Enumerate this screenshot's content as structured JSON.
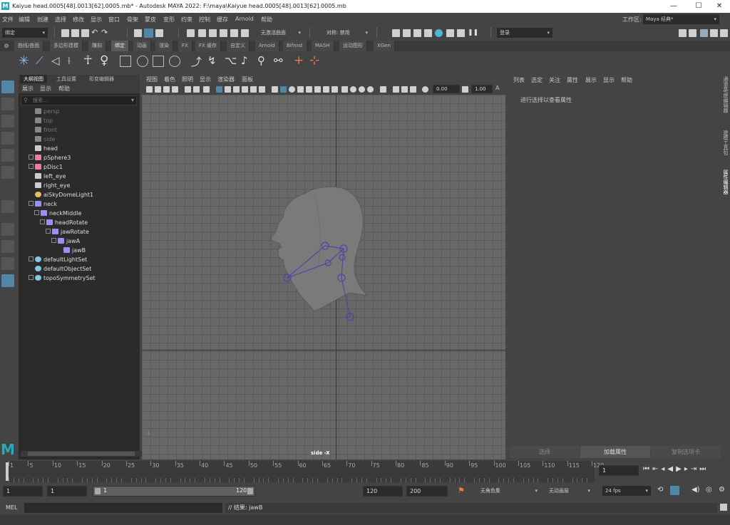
{
  "titlebar": {
    "logo": "M",
    "title": "Kaiyue head.0005[48].0013[62].0005.mb* - Autodesk MAYA 2022: F:\\maya\\Kaiyue head.0005[48].0013[62].0005.mb",
    "minimize": "—",
    "maximize": "☐",
    "close": "✕"
  },
  "menubar": {
    "items": [
      "文件",
      "编辑",
      "创建",
      "选择",
      "修改",
      "显示",
      "窗口",
      "骨架",
      "蒙皮",
      "变形",
      "约束",
      "控制",
      "缓存",
      "Arnold",
      "帮助"
    ],
    "workspace_label": "工作区:",
    "workspace_value": "Maya 经典*"
  },
  "statusline": {
    "mode": "绑定",
    "no_live_surface": "无激活曲面",
    "symmetry": "对称: 禁用",
    "login": "登录"
  },
  "shelf": {
    "tabs": [
      "曲线/曲面",
      "多边形建模",
      "雕刻",
      "绑定",
      "动画",
      "渲染",
      "FX",
      "FX 缓存",
      "自定义",
      "Arnold",
      "Bifrost",
      "MASH",
      "运动图形",
      "XGen"
    ],
    "active": "绑定"
  },
  "outliner": {
    "tabs": [
      "大纲视图",
      "工具设置",
      "形变编辑器"
    ],
    "menu": [
      "展示",
      "显示",
      "帮助"
    ],
    "search_placeholder": "搜索...",
    "items": [
      {
        "label": "persp",
        "depth": 0,
        "dim": true,
        "icon": "camera-icon",
        "expand": false
      },
      {
        "label": "top",
        "depth": 0,
        "dim": true,
        "icon": "camera-icon",
        "expand": false
      },
      {
        "label": "front",
        "depth": 0,
        "dim": true,
        "icon": "camera-icon",
        "expand": false
      },
      {
        "label": "side",
        "depth": 0,
        "dim": true,
        "icon": "camera-icon",
        "expand": false
      },
      {
        "label": "head",
        "depth": 0,
        "dim": false,
        "icon": "mesh-icon",
        "expand": false
      },
      {
        "label": "pSphere3",
        "depth": 0,
        "dim": false,
        "icon": "transform-icon",
        "expand": true
      },
      {
        "label": "pDisc1",
        "depth": 0,
        "dim": false,
        "icon": "transform-icon",
        "expand": true
      },
      {
        "label": "left_eye",
        "depth": 0,
        "dim": false,
        "icon": "mesh-icon",
        "expand": false
      },
      {
        "label": "right_eye",
        "depth": 0,
        "dim": false,
        "icon": "mesh-icon",
        "expand": false
      },
      {
        "label": "aiSkyDomeLight1",
        "depth": 0,
        "dim": false,
        "icon": "light-icon",
        "expand": false
      },
      {
        "label": "neck",
        "depth": 0,
        "dim": false,
        "icon": "joint-icon",
        "expand": true
      },
      {
        "label": "neckMiddle",
        "depth": 1,
        "dim": false,
        "icon": "joint-icon",
        "expand": true
      },
      {
        "label": "headRotate",
        "depth": 2,
        "dim": false,
        "icon": "joint-icon",
        "expand": true
      },
      {
        "label": "jawRotate",
        "depth": 3,
        "dim": false,
        "icon": "joint-icon",
        "expand": true
      },
      {
        "label": "jawA",
        "depth": 4,
        "dim": false,
        "icon": "joint-icon",
        "expand": true
      },
      {
        "label": "jawB",
        "depth": 5,
        "dim": false,
        "icon": "joint-icon",
        "expand": false
      },
      {
        "label": "defaultLightSet",
        "depth": 0,
        "dim": false,
        "icon": "set-icon",
        "expand": true
      },
      {
        "label": "defaultObjectSet",
        "depth": 0,
        "dim": false,
        "icon": "set-icon",
        "expand": false
      },
      {
        "label": "topoSymmetrySet",
        "depth": 0,
        "dim": false,
        "icon": "set-icon",
        "expand": true
      }
    ]
  },
  "viewport": {
    "menu": [
      "视图",
      "着色",
      "照明",
      "显示",
      "渲染器",
      "面板"
    ],
    "field1": "0.00",
    "field2": "1.00",
    "camera_label": "side -X"
  },
  "attribute_editor": {
    "menu": [
      "列表",
      "选定",
      "关注",
      "属性",
      "展示",
      "显示",
      "帮助"
    ],
    "hint": "进行选择以查看属性",
    "buttons": [
      "选择",
      "加载属性",
      "复制选项卡"
    ],
    "active_button": "加载属性"
  },
  "right_side_tabs": [
    "通道盒/层编辑器",
    "建模工具包",
    "属性编辑器"
  ],
  "timeline": {
    "ticks": [
      "1",
      "5",
      "10",
      "15",
      "20",
      "25",
      "30",
      "35",
      "40",
      "45",
      "50",
      "55",
      "60",
      "65",
      "70",
      "75",
      "80",
      "85",
      "90",
      "95",
      "100",
      "105",
      "110",
      "115",
      "120"
    ],
    "current_frame": "1"
  },
  "range": {
    "start": "1",
    "anim_start": "1",
    "slider_start": "1",
    "slider_end": "120",
    "end": "120",
    "anim_end": "200",
    "character_set": "无角色集",
    "anim_layer": "无动画层",
    "fps": "24 fps"
  },
  "commandline": {
    "label": "MEL",
    "result": "// 结果: jawB"
  }
}
